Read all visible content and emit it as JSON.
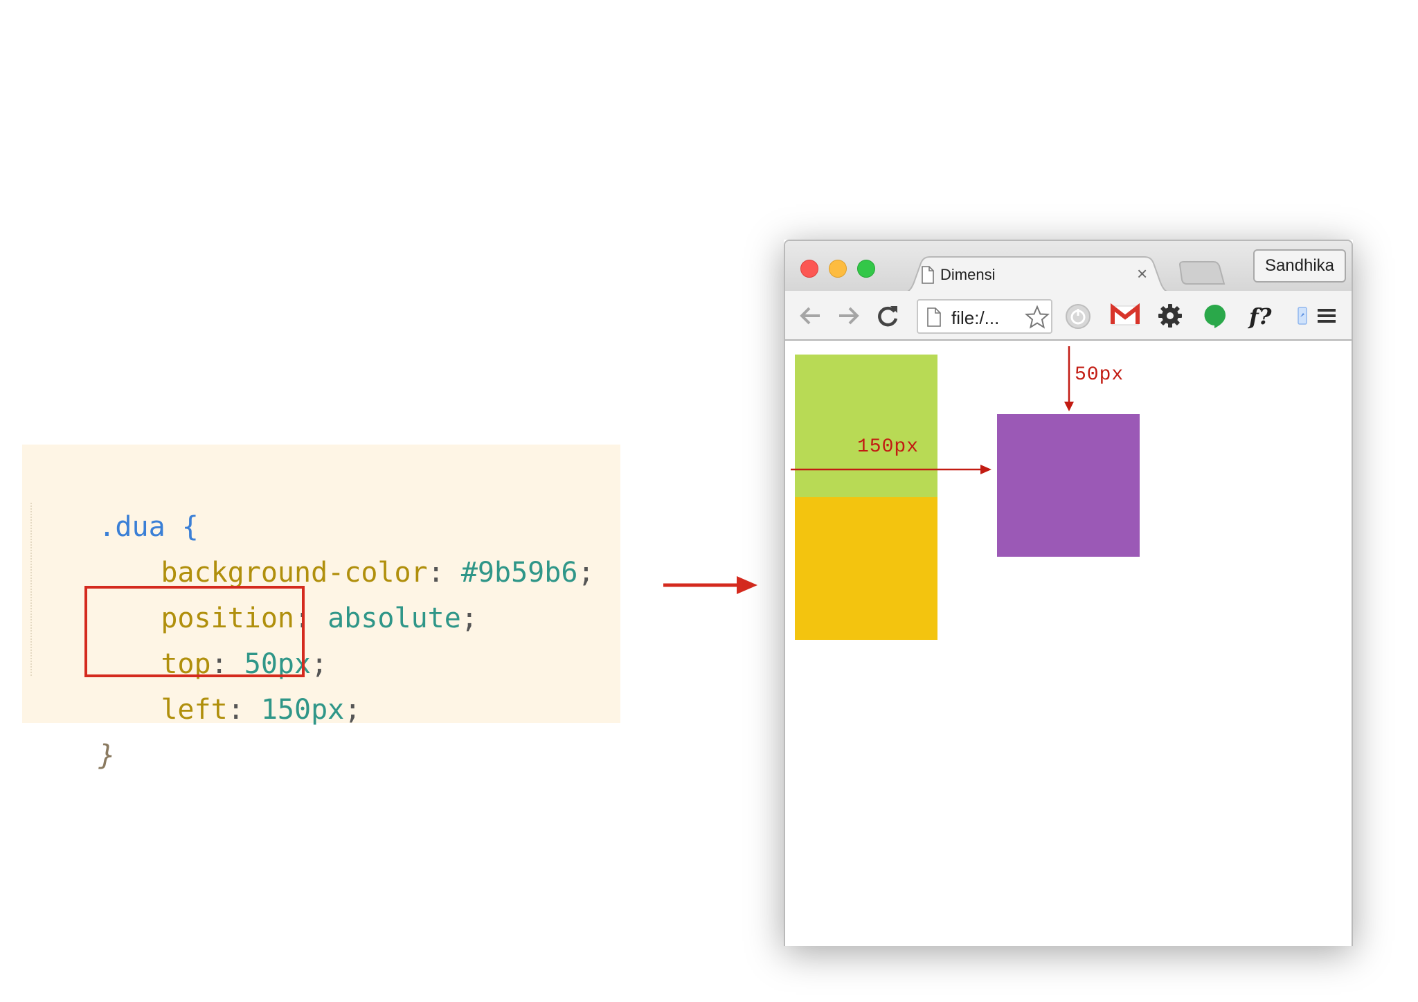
{
  "code": {
    "selector": ".dua",
    "open_brace": "{",
    "close_brace": "}",
    "declarations": [
      {
        "property": "background-color",
        "colon": ":",
        "value": "#9b59b6",
        "semi": ";"
      },
      {
        "property": "position",
        "colon": ":",
        "value": "absolute",
        "semi": ";"
      },
      {
        "property": "top",
        "colon": ":",
        "value": "50px",
        "semi": ";"
      },
      {
        "property": "left",
        "colon": ":",
        "value": "150px",
        "semi": ";"
      }
    ]
  },
  "browser": {
    "tab_title": "Dimensi",
    "tab_close": "×",
    "profile": "Sandhika",
    "address": "file:/...",
    "toolbar_icons": [
      "back-arrow-icon",
      "forward-arrow-icon",
      "reload-icon",
      "page-icon",
      "star-icon",
      "power-icon",
      "gmail-icon",
      "gear-icon",
      "hangouts-icon",
      "f-question-icon",
      "extension-icon",
      "menu-icon"
    ]
  },
  "page": {
    "boxes": [
      {
        "name": "green",
        "color": "#b8da55"
      },
      {
        "name": "yellow",
        "color": "#f3c40f"
      },
      {
        "name": "purple",
        "color": "#9b59b6"
      }
    ],
    "annotations": {
      "top_label": "50px",
      "left_label": "150px",
      "color": "#c21b12"
    }
  },
  "colors": {
    "code_background": "#fef5e5",
    "highlight_border": "#d42a1e",
    "arrow": "#d42a1e"
  }
}
